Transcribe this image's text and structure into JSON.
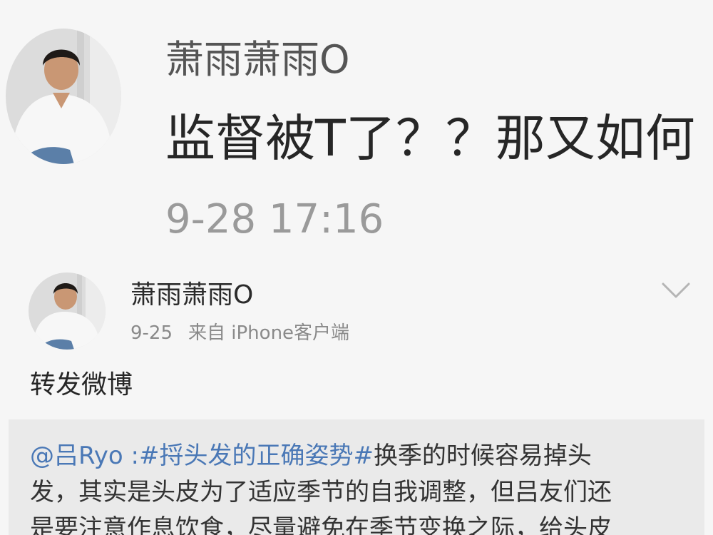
{
  "comment": {
    "author": "萧雨萧雨O",
    "text": "监督被T了？？那又如何",
    "time": "9-28 17:16"
  },
  "post": {
    "author": "萧雨萧雨O",
    "date": "9-25",
    "source": "来自 iPhone客户端",
    "body": "转发微博",
    "menu_icon": "chevron-down-icon"
  },
  "quoted": {
    "mention": "@吕Ryo",
    "colon": " :",
    "hashtag": "#捋头发的正确姿势#",
    "line1_rest": "换季的时候容易掉头",
    "line2": "发，其实是头皮为了适应季节的自我调整，但吕友们还",
    "line3": "是要注意作息饮食，尽量避免在季节变换之际，给头皮"
  },
  "colors": {
    "background": "#f6f6f6",
    "quoted_background": "#eaeaea",
    "link": "#4a78b6",
    "meta_gray": "#8a8a8a"
  }
}
